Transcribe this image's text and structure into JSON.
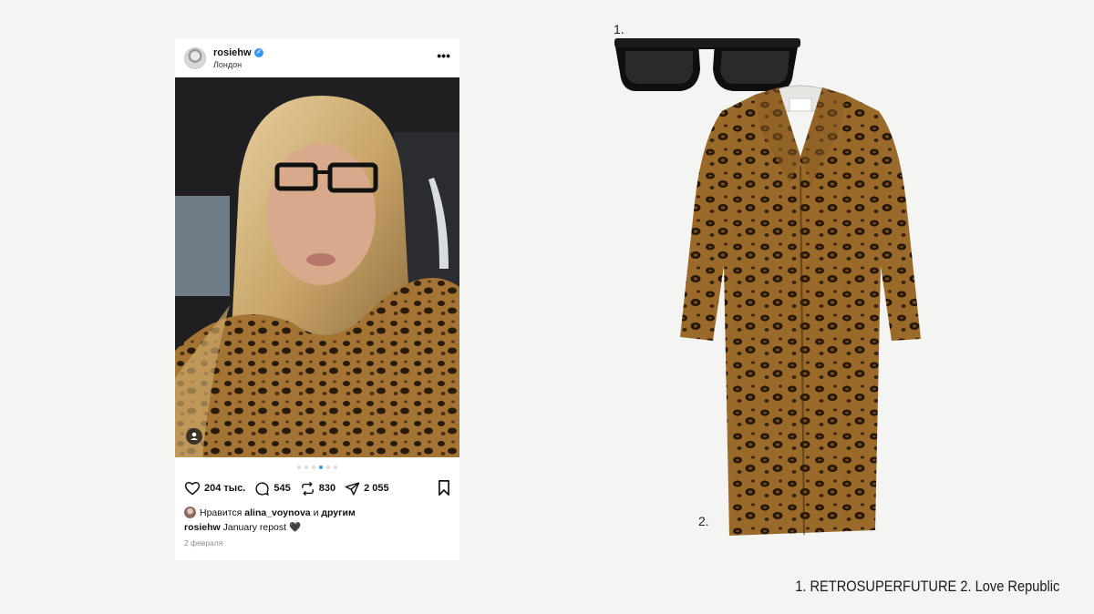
{
  "post": {
    "username": "rosiehw",
    "location": "Лондон",
    "actions": {
      "likes": "204 тыс.",
      "comments": "545",
      "reposts": "830",
      "shares": "2 055"
    },
    "liked_by": {
      "prefix": "Нравится",
      "user": "alina_voynova",
      "conj": "и",
      "others": "другим"
    },
    "caption": {
      "user": "rosiehw",
      "text": "January repost 🖤"
    },
    "date": "2 февраля",
    "carousel_dots": 6,
    "active_dot": 3
  },
  "products": {
    "item1_number": "1.",
    "item2_number": "2."
  },
  "credits": "1. RETROSUPERFUTURE 2. Love Republic",
  "colors": {
    "background": "#f4f4f2",
    "verified": "#3897f0",
    "leopard_base": "#9a6a2a"
  }
}
